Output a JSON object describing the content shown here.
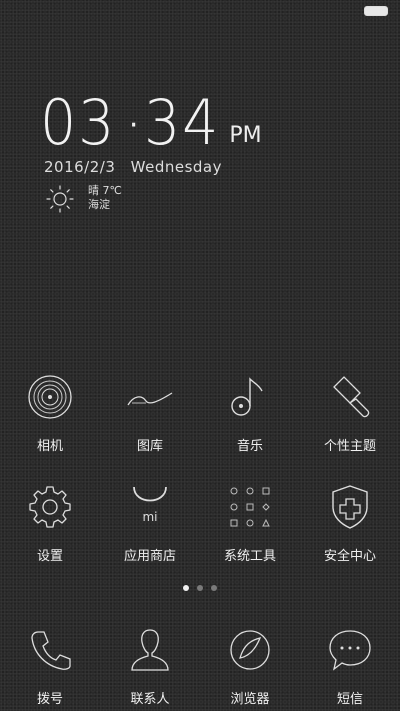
{
  "clock": {
    "hour": "03",
    "minute": "34",
    "ampm": "PM"
  },
  "date": {
    "date": "2016/2/3",
    "weekday": "Wednesday"
  },
  "weather": {
    "condition_temp": "晴 7℃",
    "location": "海淀",
    "icon": "sun-icon"
  },
  "page_indicator": {
    "count": 3,
    "active": 1
  },
  "apps_row1": [
    {
      "label": "相机",
      "icon": "camera-icon"
    },
    {
      "label": "图库",
      "icon": "gallery-icon"
    },
    {
      "label": "音乐",
      "icon": "music-icon"
    },
    {
      "label": "个性主题",
      "icon": "theme-brush-icon"
    }
  ],
  "apps_row2": [
    {
      "label": "设置",
      "icon": "gear-icon"
    },
    {
      "label": "应用商店",
      "icon": "app-store-icon"
    },
    {
      "label": "系统工具",
      "icon": "system-tools-icon"
    },
    {
      "label": "安全中心",
      "icon": "shield-icon"
    }
  ],
  "dock": [
    {
      "label": "拨号",
      "icon": "phone-icon"
    },
    {
      "label": "联系人",
      "icon": "contacts-icon"
    },
    {
      "label": "浏览器",
      "icon": "browser-icon"
    },
    {
      "label": "短信",
      "icon": "message-icon"
    }
  ]
}
